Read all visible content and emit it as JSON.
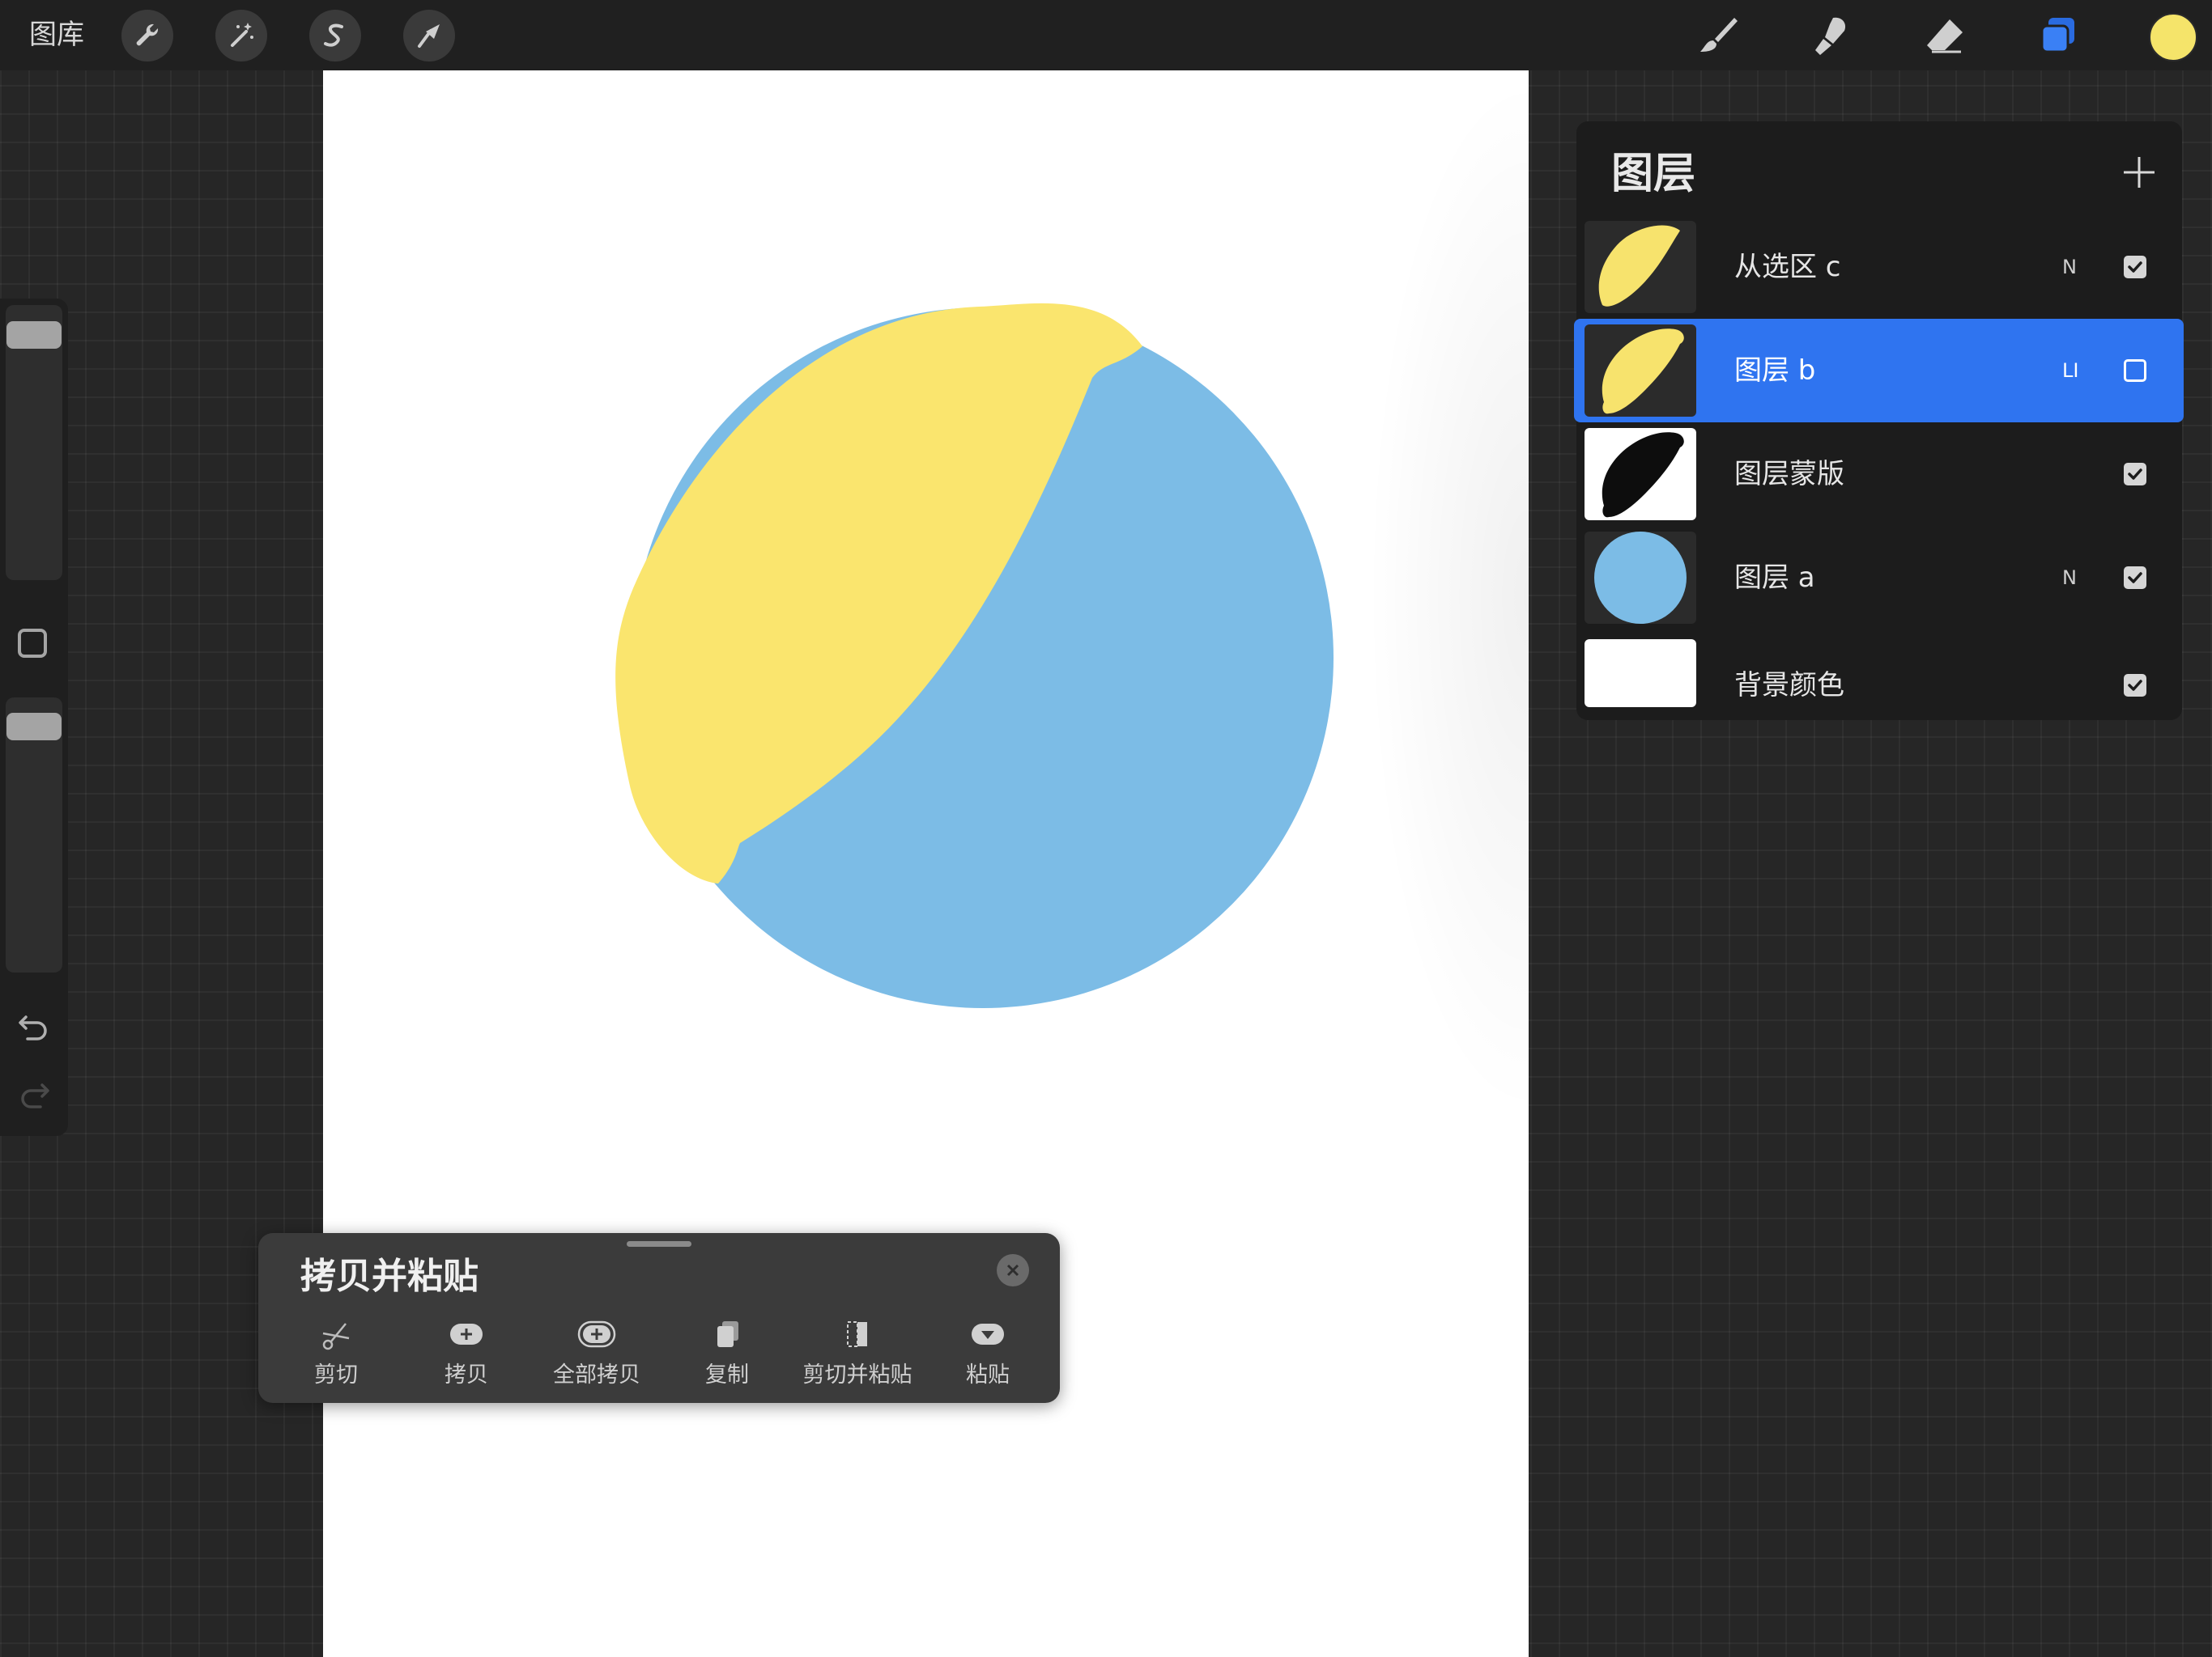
{
  "topbar": {
    "gallery_label": "图库",
    "tools": [
      "wrench-icon",
      "magic-wand-icon",
      "selection-s-icon",
      "transform-arrow-icon"
    ],
    "right_tools": [
      "brush-icon",
      "smudge-icon",
      "eraser-icon",
      "layers-icon"
    ],
    "current_color": "#F5E46A"
  },
  "canvas": {
    "background": "#FFFFFF",
    "circle_blue": "#7CBCE6",
    "shape_yellow": "#FAE56E"
  },
  "layers": {
    "title": "图层",
    "items": [
      {
        "name": "从选区 c",
        "blend": "N",
        "visible": true,
        "selected": false,
        "thumb": "yellow-leaf"
      },
      {
        "name": "图层 b",
        "blend": "LI",
        "visible": false,
        "selected": true,
        "thumb": "yellow-leaf-bumpy"
      },
      {
        "name": "图层蒙版",
        "blend": "",
        "visible": true,
        "selected": false,
        "thumb": "black-mask"
      },
      {
        "name": "图层 a",
        "blend": "N",
        "visible": true,
        "selected": false,
        "thumb": "blue-circle"
      },
      {
        "name": "背景颜色",
        "blend": "",
        "visible": true,
        "selected": false,
        "thumb": "white"
      }
    ]
  },
  "copy_paste": {
    "title": "拷贝并粘贴",
    "actions": [
      {
        "label": "剪切",
        "icon": "scissors-icon"
      },
      {
        "label": "拷贝",
        "icon": "copy-plus-icon"
      },
      {
        "label": "全部拷贝",
        "icon": "copy-all-icon"
      },
      {
        "label": "复制",
        "icon": "duplicate-icon"
      },
      {
        "label": "剪切并粘贴",
        "icon": "cut-paste-icon"
      },
      {
        "label": "粘贴",
        "icon": "paste-icon"
      }
    ]
  }
}
